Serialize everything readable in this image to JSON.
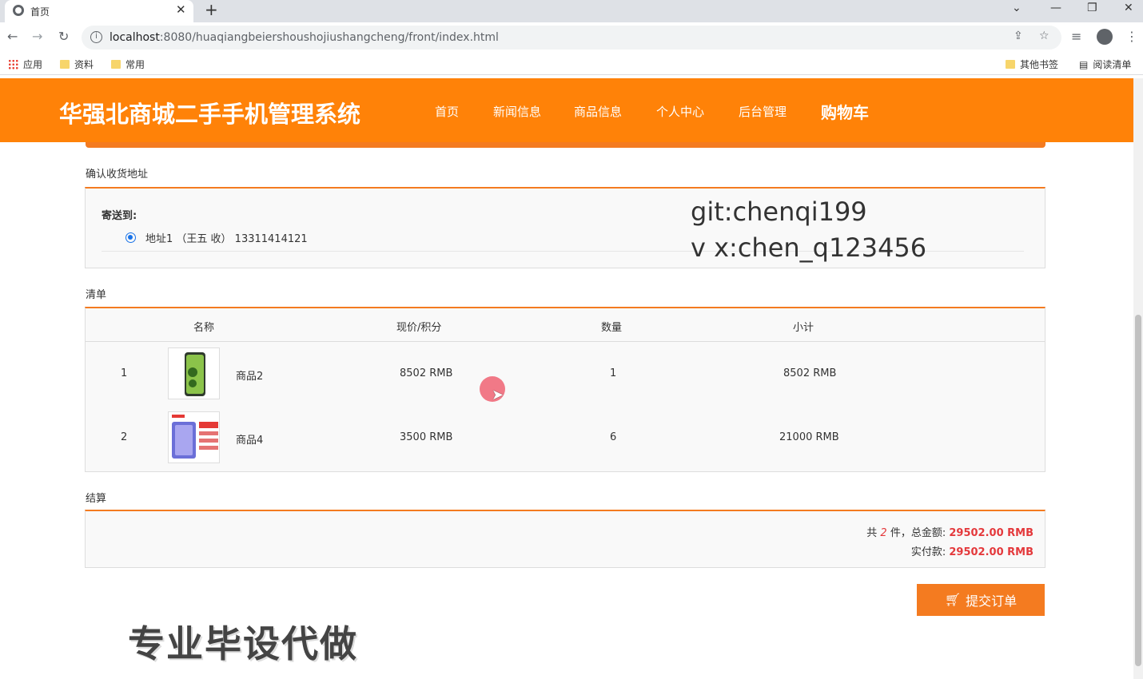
{
  "browser": {
    "tab_title": "首页",
    "url_host": "localhost",
    "url_rest": ":8080/huaqiangbeiershoushojiushangcheng/front/index.html",
    "bookmarks": [
      "应用",
      "资料",
      "常用"
    ],
    "bookmarks_right": [
      "其他书签",
      "阅读清单"
    ]
  },
  "header": {
    "logo": "华强北商城二手手机管理系统",
    "nav": [
      "首页",
      "新闻信息",
      "商品信息",
      "个人中心",
      "后台管理",
      "购物车"
    ]
  },
  "address": {
    "section_label": "确认收货地址",
    "to_label": "寄送到:",
    "option": "地址1 （王五 收） 13311414121"
  },
  "watermark": [
    "git:chenqi199",
    "v x:chen_q123456"
  ],
  "list": {
    "section_label": "清单",
    "columns": [
      "名称",
      "现价/积分",
      "数量",
      "小计"
    ],
    "rows": [
      {
        "index": "1",
        "name": "商品2",
        "price": "8502 RMB",
        "qty": "1",
        "subtotal": "8502 RMB"
      },
      {
        "index": "2",
        "name": "商品4",
        "price": "3500 RMB",
        "qty": "6",
        "subtotal": "21000 RMB"
      }
    ]
  },
  "settle": {
    "section_label": "结算",
    "count_prefix": "共",
    "count": "2",
    "count_suffix": "件，总金额:",
    "total": "29502.00 RMB",
    "paid_label": "实付款:",
    "paid": "29502.00 RMB"
  },
  "submit_label": "提交订单",
  "promo": "专业毕设代做",
  "colors": {
    "accent": "#ff8208",
    "amount": "#e4393c"
  }
}
